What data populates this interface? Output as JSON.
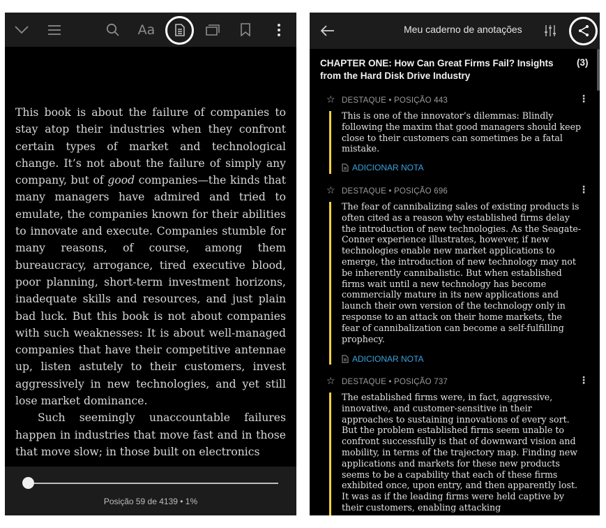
{
  "reader": {
    "toolbar": {
      "icons": [
        "chevron-down-icon",
        "menu-icon",
        "search-icon",
        "font-settings-icon",
        "notebook-icon",
        "page-flip-icon",
        "bookmark-icon",
        "more-options-icon"
      ],
      "font_label": "Aa"
    },
    "paragraph1": {
      "before": "This book is about the failure of companies to stay atop their industries when they confront certain types of market and technological change. It’s not about the failure of simply any company, but of ",
      "emphasis": "good",
      "after": " companies—the kinds that many managers have admired and tried to emulate, the companies known for their abilities to innovate and execute. Companies stumble for many reasons, of course, among them bureaucracy, arrogance, tired executive blood, poor planning, short-term investment horizons, inadequate skills and resources, and just plain bad luck. But this book is not about companies with such weaknesses: It is about well-managed companies that have their competitive antennae up, listen astutely to their customers, invest aggressively in new technologies, and yet still lose market dominance."
    },
    "paragraph2": "Such seemingly unaccountable failures happen in industries that move fast and in those that move slow; in those built on electronics",
    "progress_fraction": 0.01,
    "position_label": "Posição 59 de 4139 • 1%"
  },
  "notebook": {
    "title": "Meu caderno de anotações",
    "chapter_title": "CHAPTER ONE: How Can Great Firms Fail? Insights from the Hard Disk Drive Industry",
    "chapter_count": "(3)",
    "add_note_label": "ADICIONAR NOTA",
    "highlights": [
      {
        "meta": "DESTAQUE • POSIÇÃO 443",
        "text": "This is one of the innovator’s dilemmas: Blindly following the maxim that good managers should keep close to their customers can sometimes be a fatal mistake."
      },
      {
        "meta": "DESTAQUE • POSIÇÃO 696",
        "text": "The fear of cannibalizing sales of existing products is often cited as a reason why established firms delay the introduction of new technologies. As the Seagate-Conner experience illustrates, however, if new technologies enable new market applications to emerge, the introduction of new technology may not be inherently cannibalistic. But when established firms wait until a new technology has become commercially mature in its new applications and launch their own version of the technology only in response to an attack on their home markets, the fear of cannibalization can become a self-fulfilling prophecy."
      },
      {
        "meta": "DESTAQUE • POSIÇÃO 737",
        "text": "The established firms were, in fact, aggressive, innovative, and customer-sensitive in their approaches to sustaining innovations of every sort. But the problem established firms seem unable to confront successfully is that of downward vision and mobility, in terms of the trajectory map. Finding new applications and markets for these new products seems to be a capability that each of these firms exhibited once, upon entry, and then apparently lost. It was as if the leading firms were held captive by their customers, enabling attacking"
      }
    ]
  },
  "colors": {
    "highlight_bar": "#f4d03f",
    "link": "#3aa3e0",
    "toolbar_bg": "#1c1c1c",
    "page_bg": "#000000"
  }
}
